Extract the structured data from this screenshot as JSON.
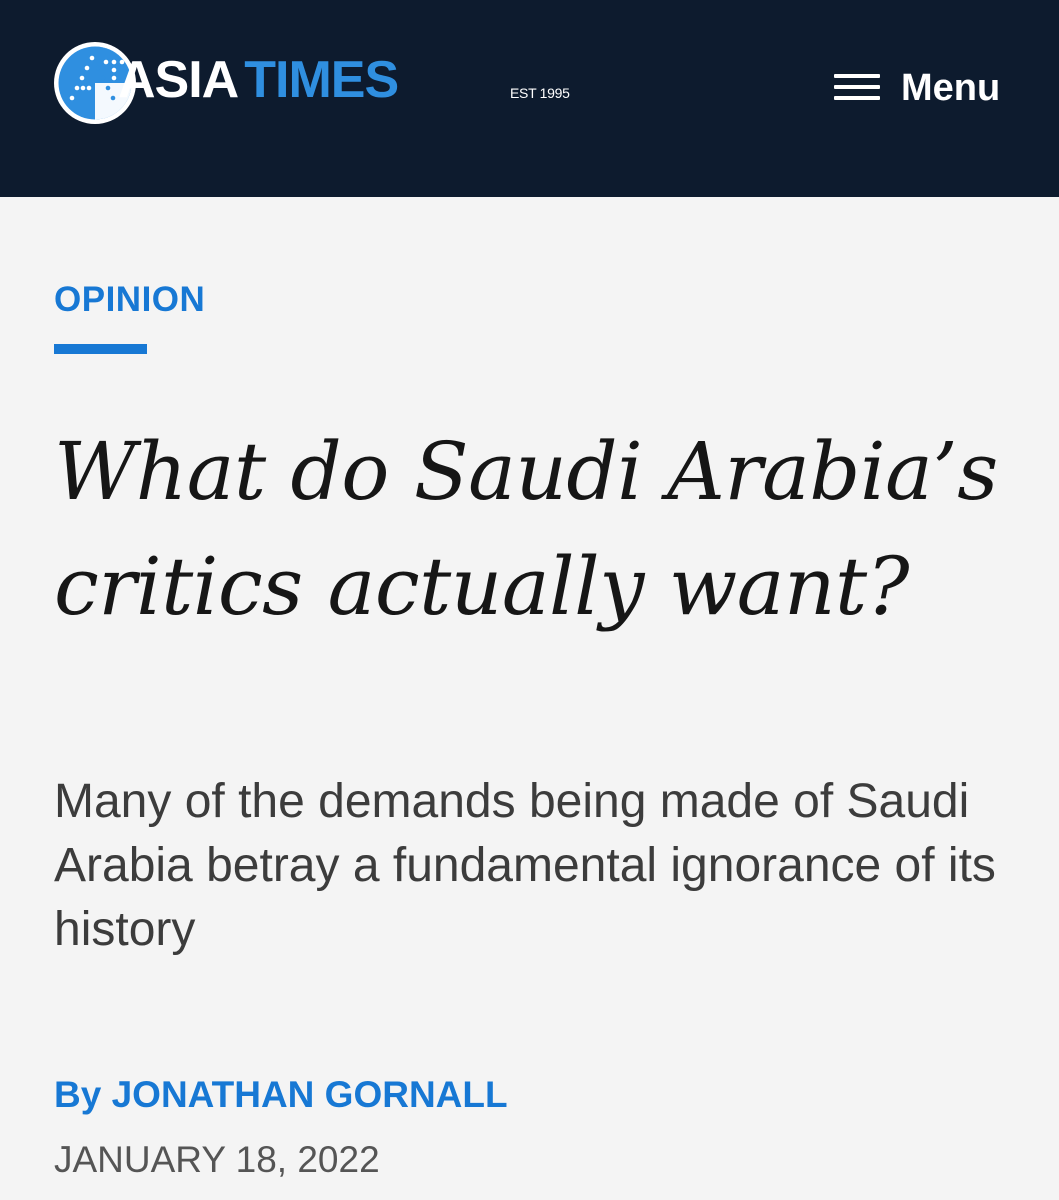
{
  "header": {
    "logo_icon": "asia-times-logo-icon",
    "logo_word_1": "ASIA",
    "logo_word_2": "TIMES",
    "est": "EST 1995",
    "menu_icon": "hamburger-icon",
    "menu_label": "Menu"
  },
  "article": {
    "category": "OPINION",
    "headline": "What do Saudi Arabia’s critics actu­ally want?",
    "subheadline": "Many of the demands being made of Saudi Arabia betray a fundamental ignorance of its history",
    "byline_prefix": "By",
    "author": "JONATHAN GORNALL",
    "date": "JANUARY 18, 2022"
  },
  "colors": {
    "header_bg": "#0d1b2e",
    "page_bg": "#f4f4f4",
    "accent_blue": "#1778d4",
    "logo_blue": "#2f8fe0",
    "headline_text": "#161616",
    "subhead_text": "#3c3c3c",
    "date_text": "#555555"
  }
}
